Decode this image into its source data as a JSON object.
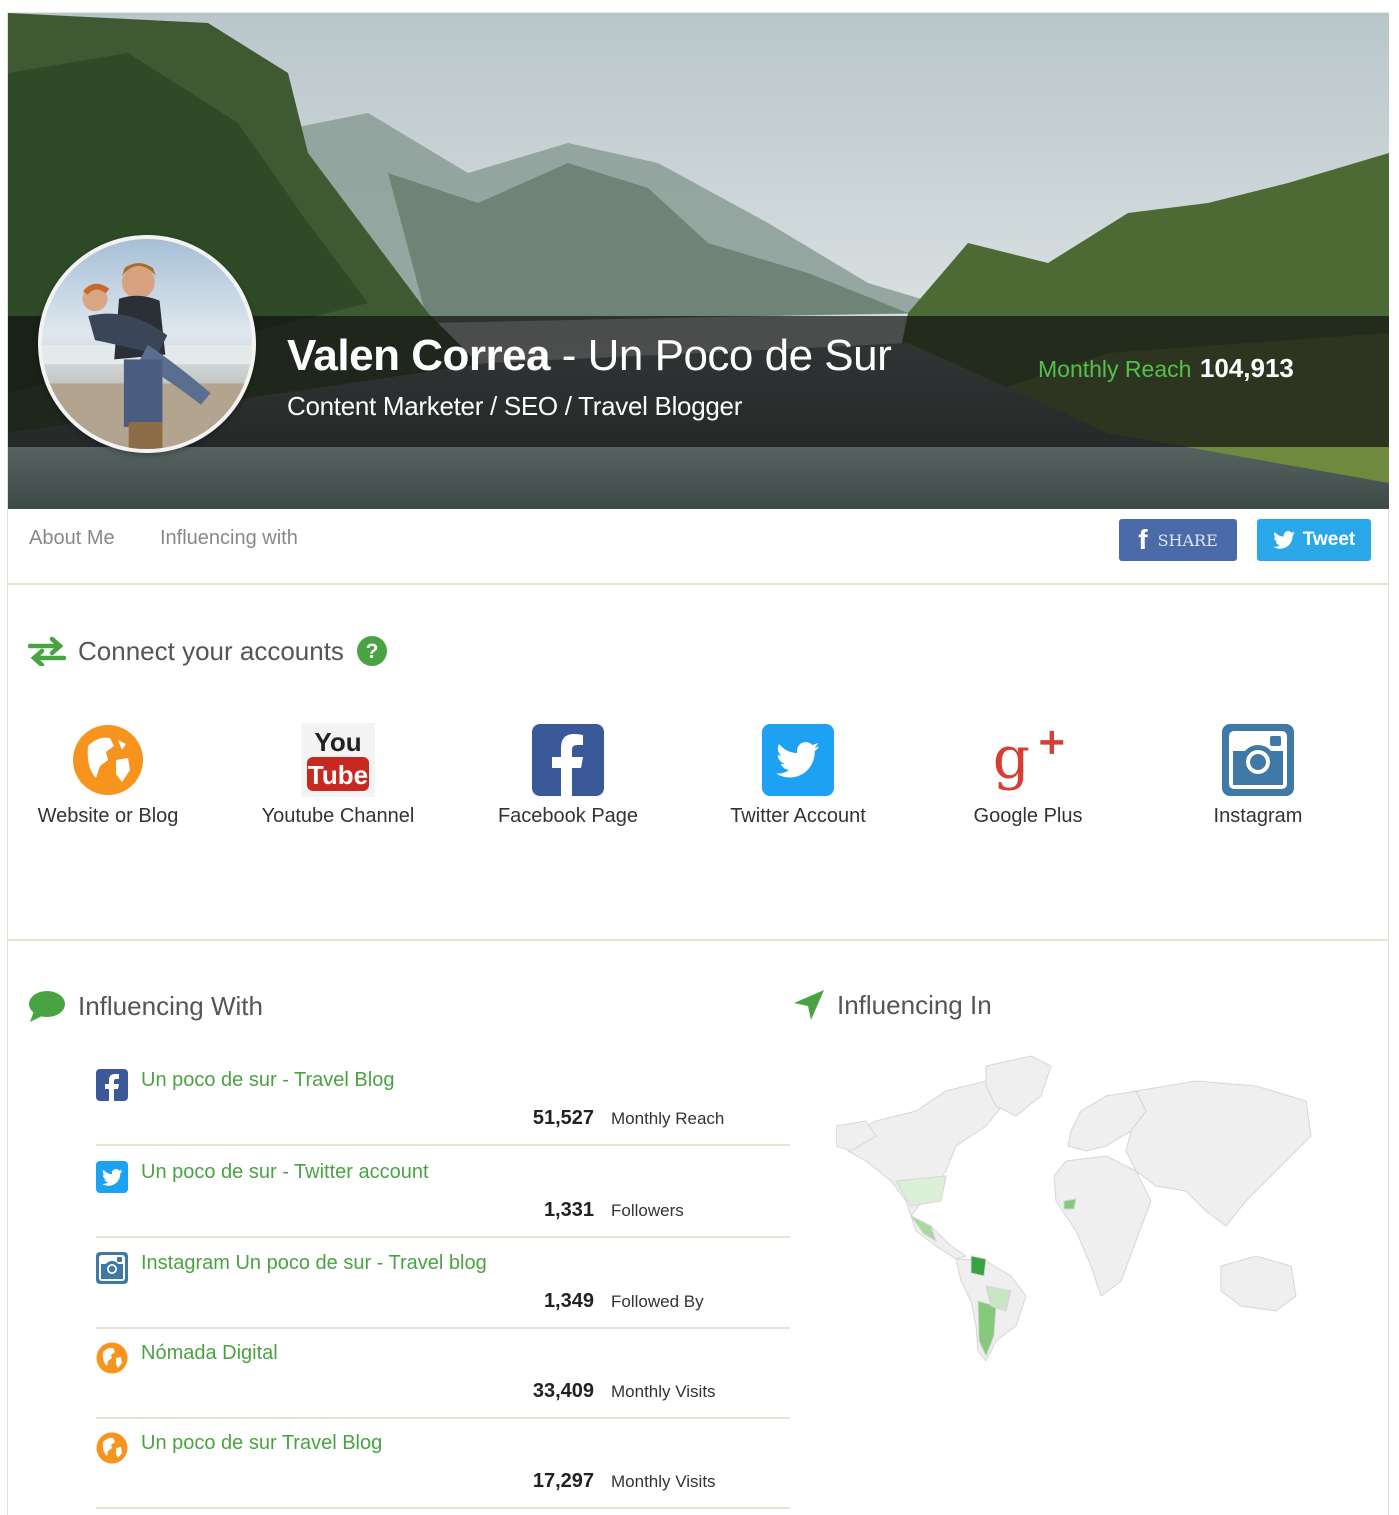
{
  "profile": {
    "name": "Valen Correa",
    "separator": " - ",
    "blog": "Un Poco de Sur",
    "title": "Content Marketer / SEO / Travel Blogger",
    "monthly_reach_label": "Monthly Reach",
    "monthly_reach_value": "104,913"
  },
  "nav": {
    "about": "About Me",
    "influencing": "Influencing with",
    "share_label": "SHARE",
    "tweet_label": "Tweet"
  },
  "connect": {
    "heading": "Connect your accounts",
    "accounts": [
      {
        "label": "Website or Blog",
        "icon": "globe-icon"
      },
      {
        "label": "Youtube Channel",
        "icon": "youtube-icon"
      },
      {
        "label": "Facebook Page",
        "icon": "facebook-icon"
      },
      {
        "label": "Twitter Account",
        "icon": "twitter-icon"
      },
      {
        "label": "Google Plus",
        "icon": "google-plus-icon"
      },
      {
        "label": "Instagram",
        "icon": "instagram-icon"
      }
    ]
  },
  "influencing_with": {
    "heading": "Influencing With",
    "items": [
      {
        "name": "Un poco de sur - Travel Blog",
        "value": "51,527",
        "unit": "Monthly Reach",
        "icon": "facebook-icon"
      },
      {
        "name": "Un poco de sur - Twitter account",
        "value": "1,331",
        "unit": "Followers",
        "icon": "twitter-icon"
      },
      {
        "name": "Instagram Un poco de sur - Travel blog",
        "value": "1,349",
        "unit": "Followed By",
        "icon": "instagram-icon"
      },
      {
        "name": "Nómada Digital",
        "value": "33,409",
        "unit": "Monthly Visits",
        "icon": "globe-icon"
      },
      {
        "name": "Un poco de sur Travel Blog",
        "value": "17,297",
        "unit": "Monthly Visits",
        "icon": "globe-icon"
      }
    ]
  },
  "influencing_in": {
    "heading": "Influencing In"
  },
  "colors": {
    "accent_green": "#4aa342",
    "facebook": "#3b5998",
    "twitter": "#1da1f2",
    "orange": "#f7941d"
  }
}
